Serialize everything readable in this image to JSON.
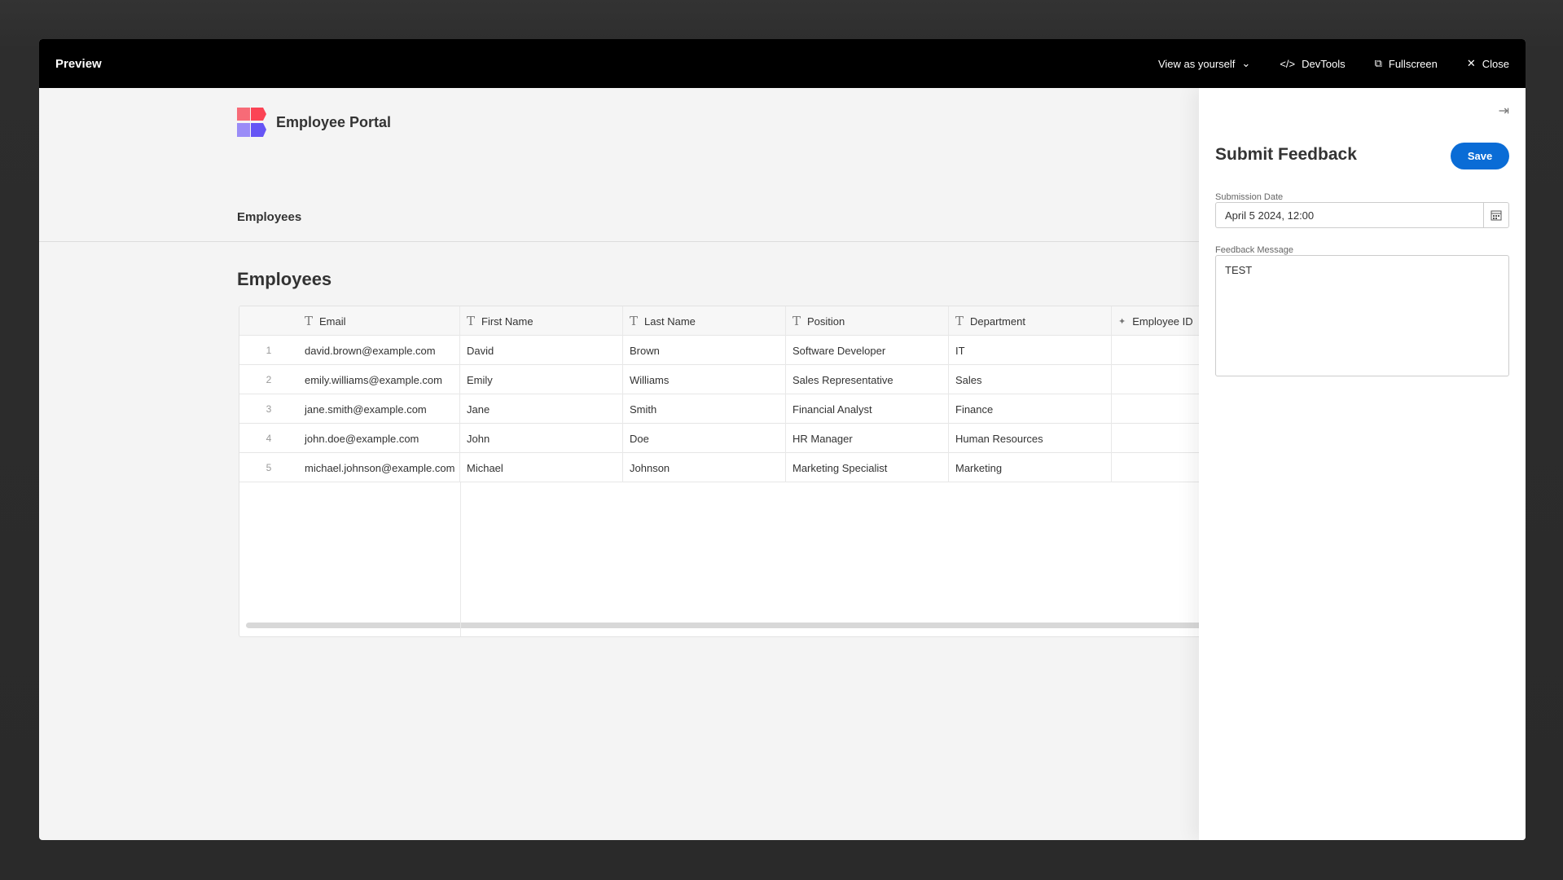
{
  "modal": {
    "title": "Preview",
    "view_as": "View as yourself",
    "devtools": "DevTools",
    "fullscreen": "Fullscreen",
    "close": "Close"
  },
  "app": {
    "name": "Employee Portal",
    "nav": "Employees",
    "heading": "Employees"
  },
  "table": {
    "columns": [
      {
        "label": "Email",
        "icon": "text-icon"
      },
      {
        "label": "First Name",
        "icon": "text-icon"
      },
      {
        "label": "Last Name",
        "icon": "text-icon"
      },
      {
        "label": "Position",
        "icon": "text-icon"
      },
      {
        "label": "Department",
        "icon": "text-icon"
      },
      {
        "label": "Employee ID",
        "icon": "magic-wand-icon"
      }
    ],
    "rows": [
      [
        "1",
        "david.brown@example.com",
        "David",
        "Brown",
        "Software Developer",
        "IT",
        ""
      ],
      [
        "2",
        "emily.williams@example.com",
        "Emily",
        "Williams",
        "Sales Representative",
        "Sales",
        ""
      ],
      [
        "3",
        "jane.smith@example.com",
        "Jane",
        "Smith",
        "Financial Analyst",
        "Finance",
        ""
      ],
      [
        "4",
        "john.doe@example.com",
        "John",
        "Doe",
        "HR Manager",
        "Human Resources",
        ""
      ],
      [
        "5",
        "michael.johnson@example.com",
        "Michael",
        "Johnson",
        "Marketing Specialist",
        "Marketing",
        ""
      ]
    ]
  },
  "panel": {
    "title": "Submit Feedback",
    "save": "Save",
    "date_label": "Submission Date",
    "date_value": "April 5 2024, 12:00",
    "message_label": "Feedback Message",
    "message_value": "TEST"
  },
  "colors": {
    "accent": "#0a6cd6"
  }
}
